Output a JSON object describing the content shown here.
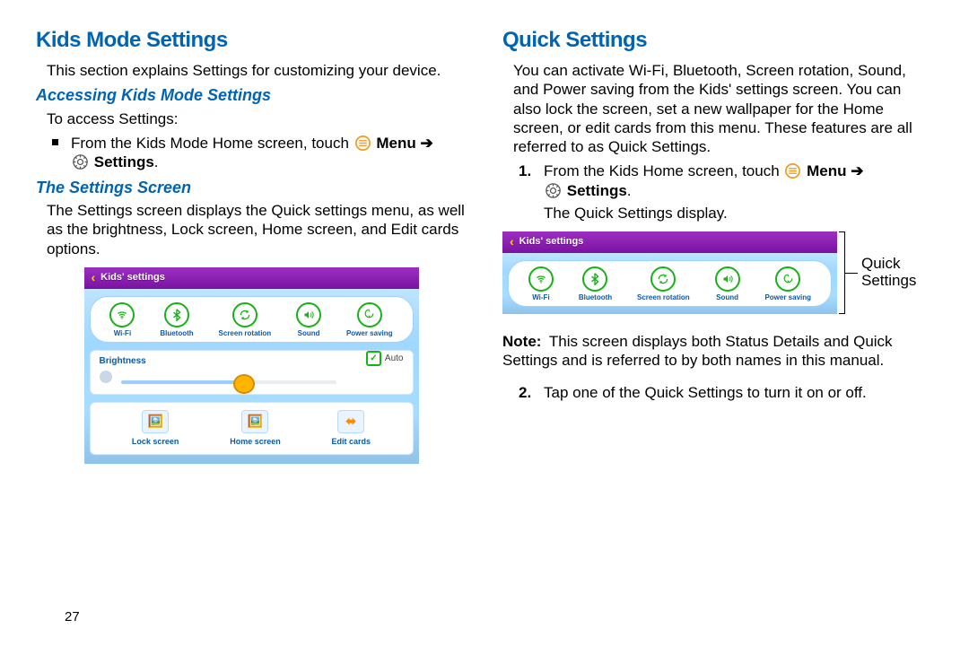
{
  "left": {
    "h1": "Kids Mode Settings",
    "intro": "This section explains Settings for customizing your device.",
    "h2a": "Accessing Kids Mode Settings",
    "access_lead": "To access Settings:",
    "bullet_pre": "From the Kids Mode Home screen, touch ",
    "bullet_menu": "Menu",
    "bullet_settings": "Settings",
    "h2b": "The Settings Screen",
    "screen_p": "The Settings screen displays the Quick settings menu, as well as the brightness, Lock screen, Home screen, and Edit cards options."
  },
  "right": {
    "h1": "Quick Settings",
    "intro": "You can activate Wi-Fi, Bluetooth, Screen rotation, Sound, and Power saving from the Kids' settings screen. You can also lock the screen, set a new wallpaper for the Home screen, or edit cards from this menu. These features are all referred to as Quick Settings.",
    "step1_pre": "From the Kids Home screen, touch ",
    "step1_menu": "Menu",
    "step1_settings": "Settings",
    "step1_tail": "The Quick Settings display.",
    "qs_anno_l1": "Quick",
    "qs_anno_l2": "Settings",
    "note_label": "Note:",
    "note_text": "This screen displays both Status Details and Quick Settings and is referred to by both names in this manual.",
    "step2": "Tap one of the Quick Settings to turn it on or off."
  },
  "panel": {
    "back": "Kids' settings",
    "qs": [
      {
        "label": "Wi-Fi"
      },
      {
        "label": "Bluetooth"
      },
      {
        "label": "Screen rotation"
      },
      {
        "label": "Sound"
      },
      {
        "label": "Power saving"
      }
    ],
    "brightness": "Brightness",
    "auto": "Auto",
    "cards": [
      {
        "label": "Lock screen"
      },
      {
        "label": "Home screen"
      },
      {
        "label": "Edit cards"
      }
    ]
  },
  "page_number": "27"
}
